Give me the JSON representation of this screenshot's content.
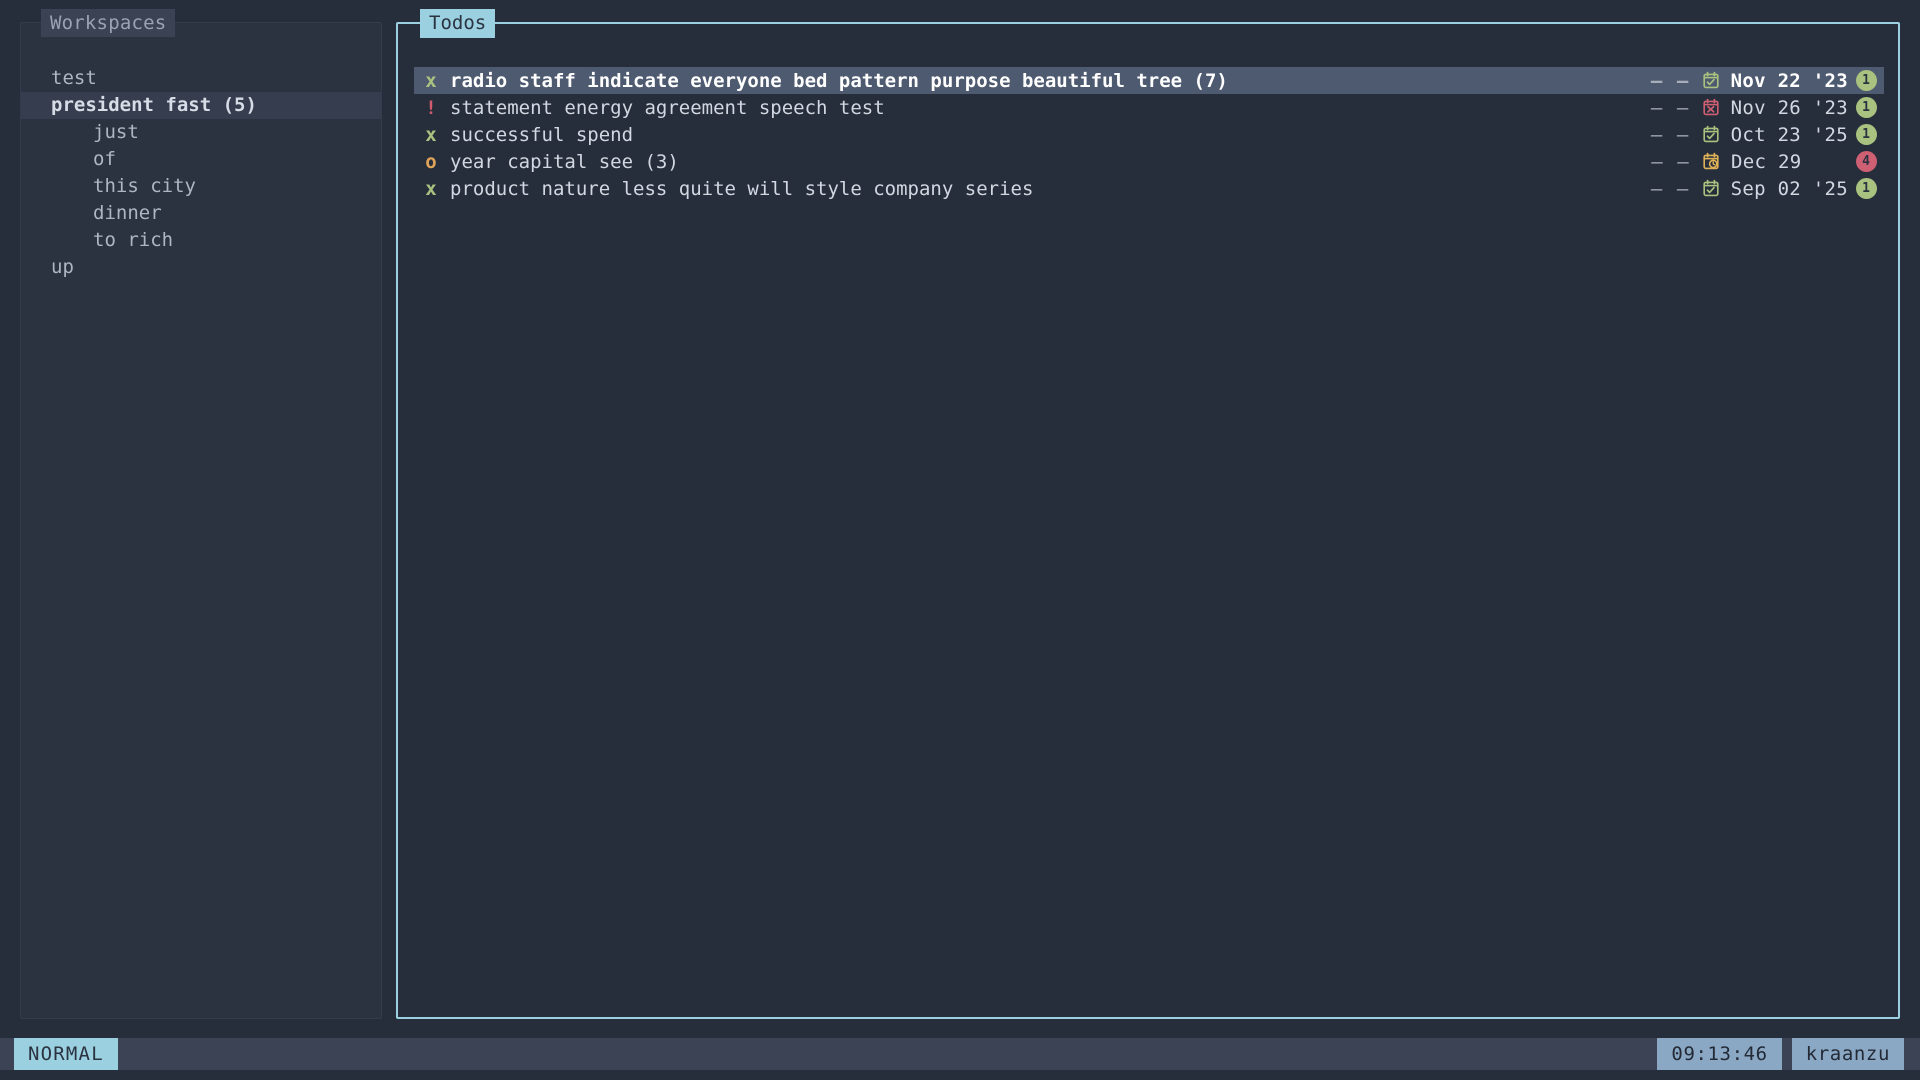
{
  "theme": {
    "bg": "#272e3b",
    "panel_bg": "#2b3240",
    "accent": "#9ad0e0",
    "selection_bg": "#4e5a70",
    "done_color": "#a9c27f",
    "urgent_color": "#d05a6e",
    "progress_color": "#e0a458",
    "badge_green": "#a9c27f",
    "badge_red": "#cf5f72",
    "statusbar_bg": "#3b4354",
    "status_chip_bg": "#8aa8c4"
  },
  "workspaces": {
    "title": "Workspaces",
    "items": [
      {
        "label": "test",
        "indent": false,
        "selected": false
      },
      {
        "label": "president fast (5)",
        "indent": false,
        "selected": true
      },
      {
        "label": "just",
        "indent": true,
        "selected": false
      },
      {
        "label": "of",
        "indent": true,
        "selected": false
      },
      {
        "label": "this city",
        "indent": true,
        "selected": false
      },
      {
        "label": "dinner",
        "indent": true,
        "selected": false
      },
      {
        "label": "to rich",
        "indent": true,
        "selected": false
      },
      {
        "label": "up",
        "indent": false,
        "selected": false
      }
    ]
  },
  "todos": {
    "title": "Todos",
    "dash": "–",
    "items": [
      {
        "marker": "x",
        "marker_state": "done",
        "text": "radio staff indicate everyone bed pattern purpose beautiful tree (7)",
        "col_a": "–",
        "col_b": "–",
        "calendar_icon": "calendar-check-icon",
        "date": "Nov 22 '23",
        "badge": "1",
        "badge_color": "green",
        "selected": true
      },
      {
        "marker": "!",
        "marker_state": "urgent",
        "text": "statement energy agreement speech test",
        "col_a": "–",
        "col_b": "–",
        "calendar_icon": "calendar-x-icon",
        "date": "Nov 26 '23",
        "badge": "1",
        "badge_color": "green",
        "selected": false
      },
      {
        "marker": "x",
        "marker_state": "done",
        "text": "successful spend",
        "col_a": "–",
        "col_b": "–",
        "calendar_icon": "calendar-check-icon",
        "date": "Oct 23 '25",
        "badge": "1",
        "badge_color": "green",
        "selected": false
      },
      {
        "marker": "o",
        "marker_state": "prog",
        "text": "year capital see (3)",
        "col_a": "–",
        "col_b": "–",
        "calendar_icon": "calendar-clock-icon",
        "date": "Dec 29",
        "badge": "4",
        "badge_color": "red",
        "selected": false
      },
      {
        "marker": "x",
        "marker_state": "done",
        "text": "product nature less quite will style company series",
        "col_a": "–",
        "col_b": "–",
        "calendar_icon": "calendar-check-icon",
        "date": "Sep 02 '25",
        "badge": "1",
        "badge_color": "green",
        "selected": false
      }
    ]
  },
  "statusbar": {
    "mode": "NORMAL",
    "clock": "09:13:46",
    "user": "kraanzu"
  }
}
